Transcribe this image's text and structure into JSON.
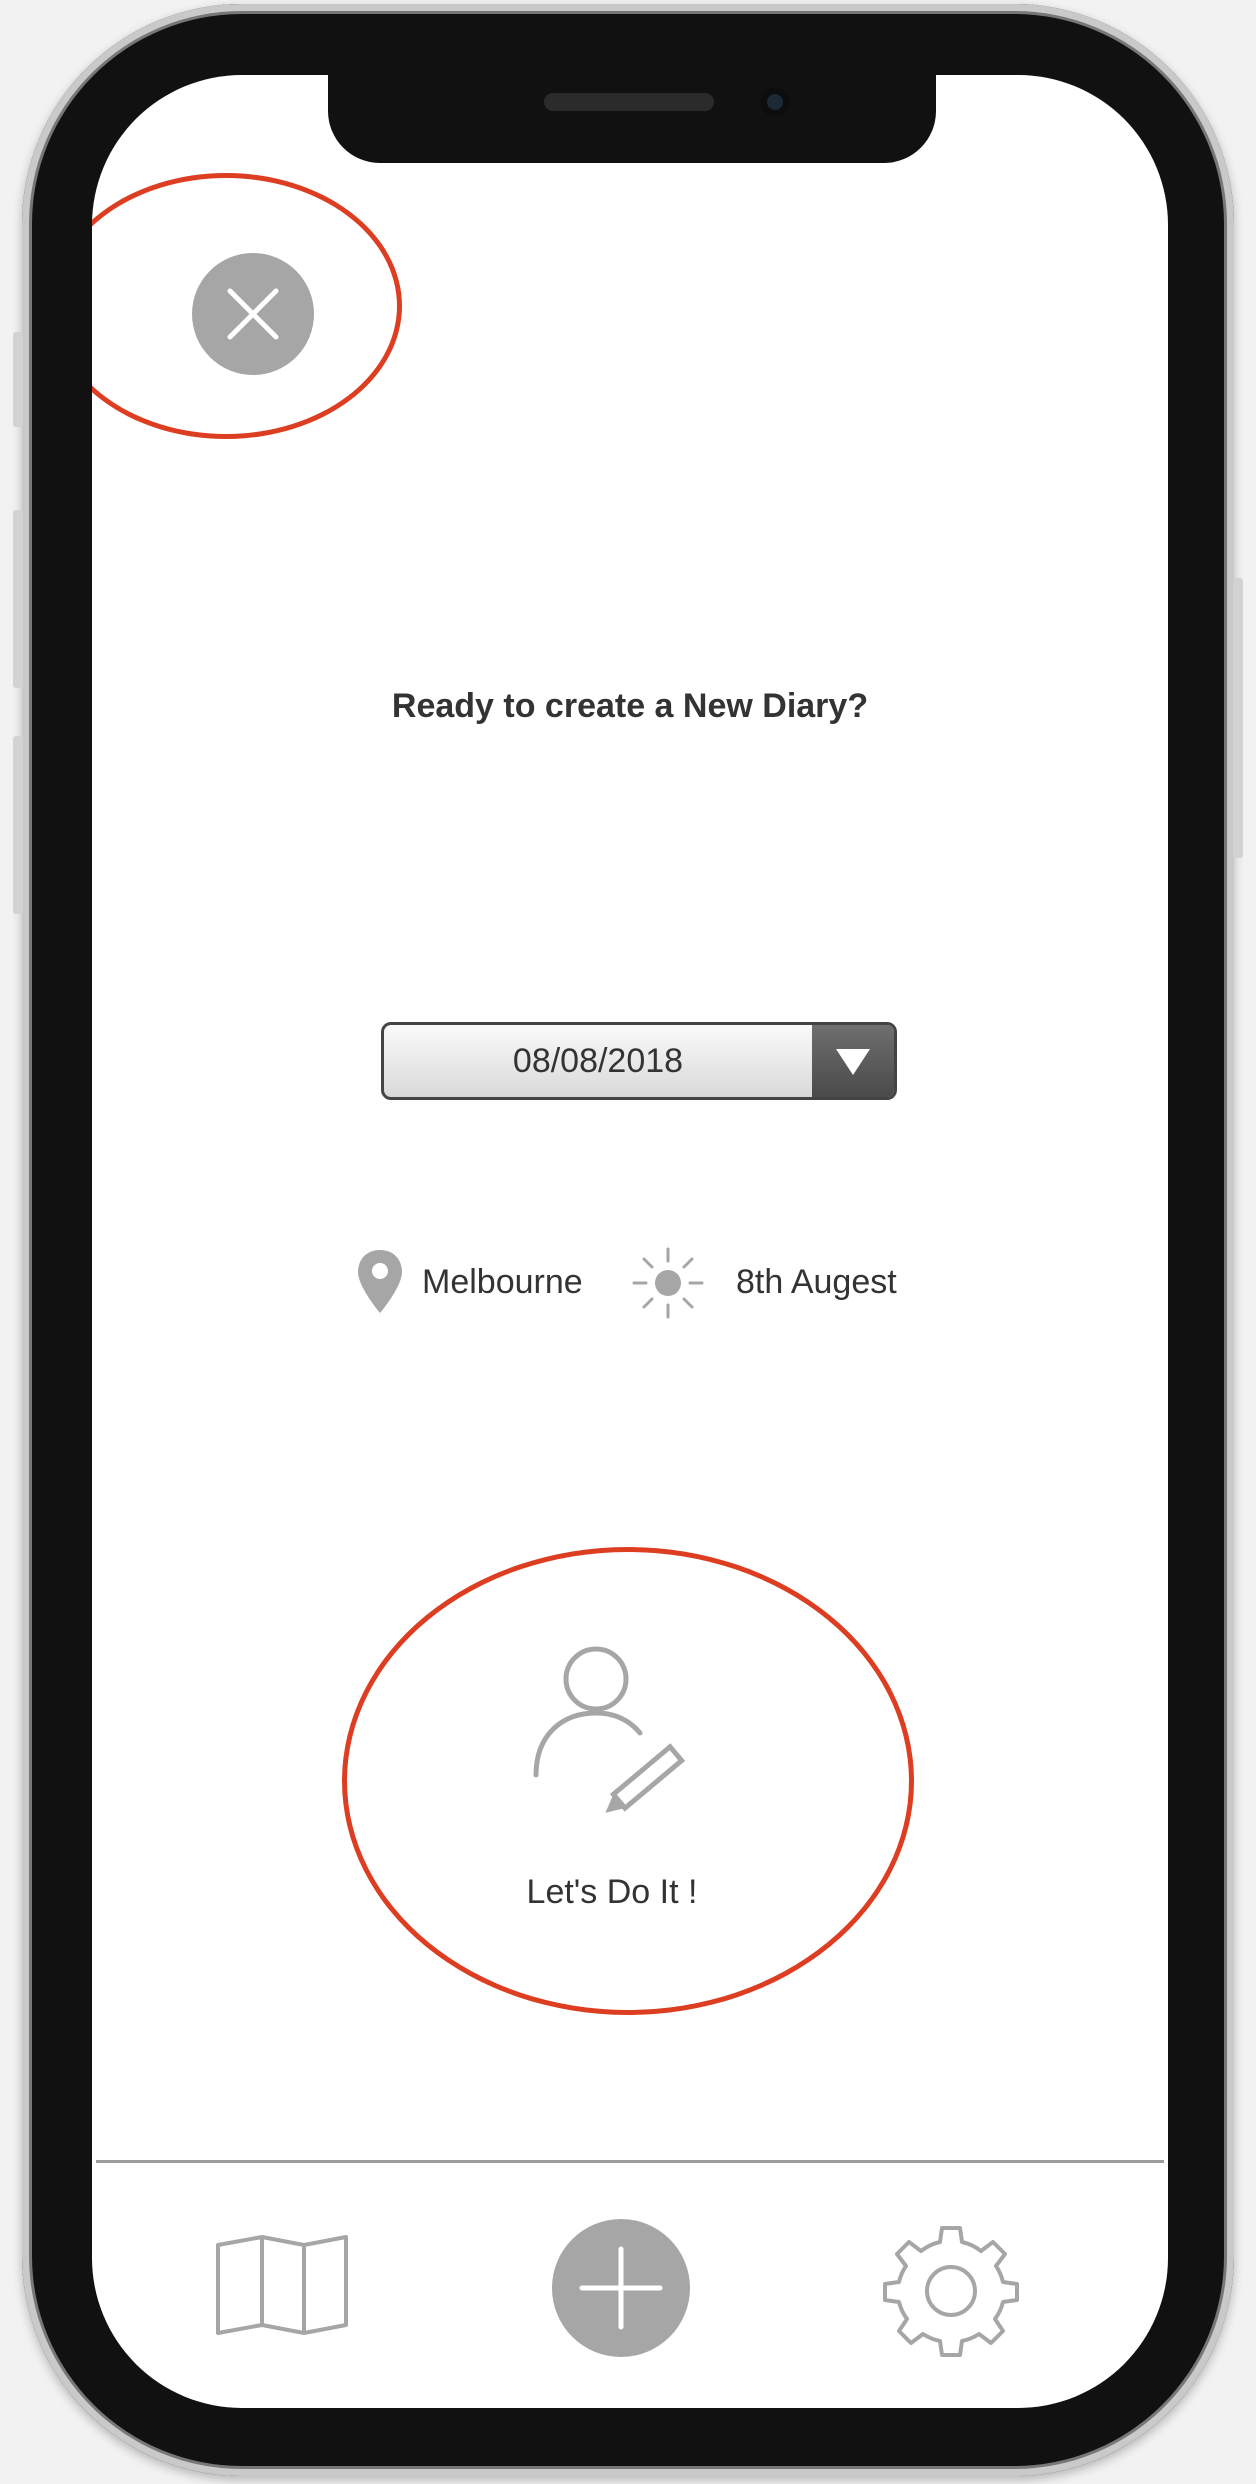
{
  "screen": {
    "title": "Ready to create a New Diary?",
    "date_picker": {
      "value": "08/08/2018"
    },
    "location": "Melbourne",
    "weather_date": "8th Augest",
    "cta_label": "Let's Do It !"
  },
  "icons": {
    "close": "close-icon",
    "dropdown": "triangle-down-icon",
    "location": "map-pin-icon",
    "weather": "sun-icon",
    "cta": "user-edit-icon",
    "nav": [
      "map-icon",
      "plus-icon",
      "gear-icon"
    ]
  },
  "colors": {
    "annotation": "#dd3e22",
    "icon_gray": "#a6a6a6",
    "text": "#333333"
  }
}
